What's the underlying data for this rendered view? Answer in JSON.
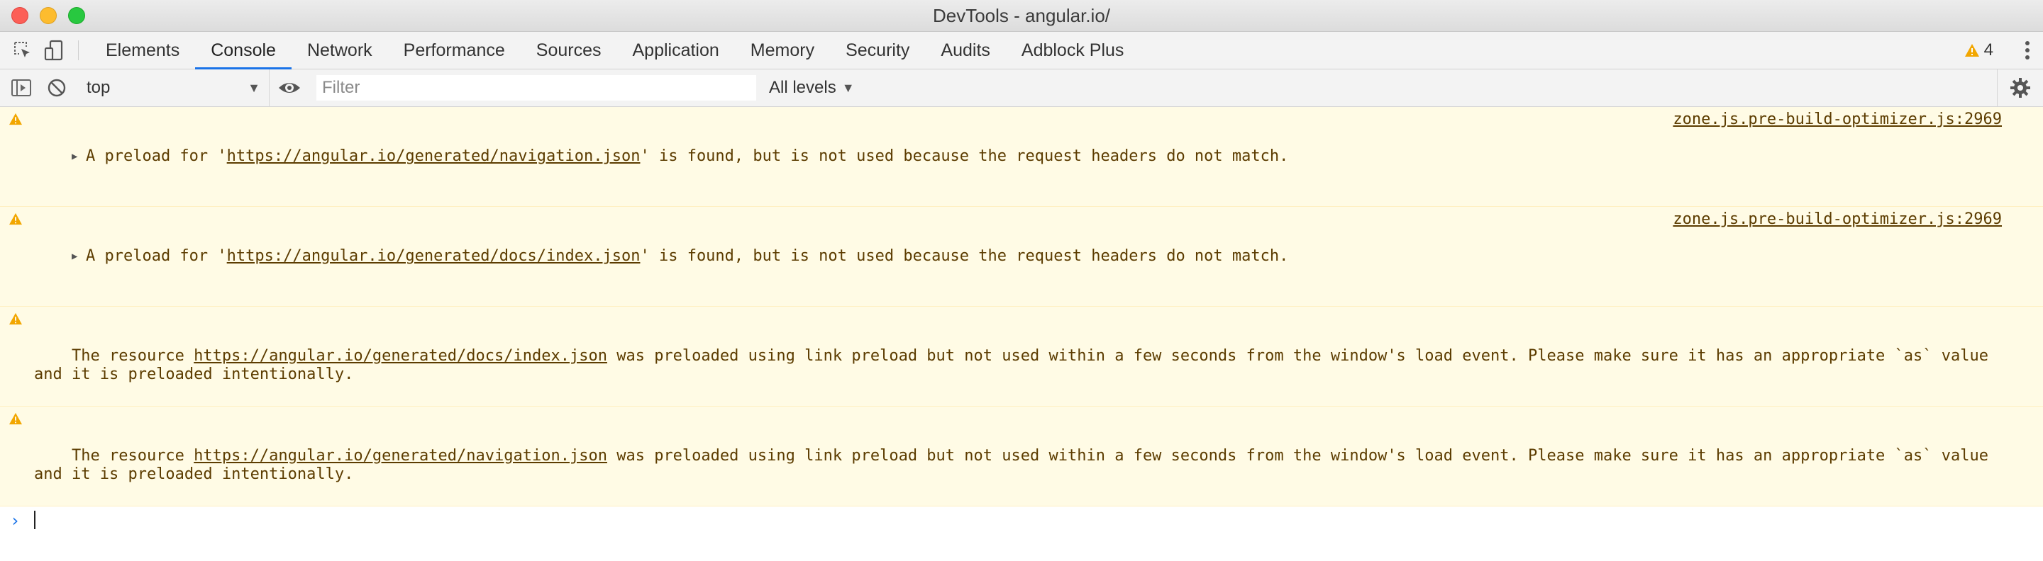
{
  "window": {
    "title": "DevTools - angular.io/"
  },
  "tabs": [
    {
      "label": "Elements"
    },
    {
      "label": "Console",
      "active": true
    },
    {
      "label": "Network"
    },
    {
      "label": "Performance"
    },
    {
      "label": "Sources"
    },
    {
      "label": "Application"
    },
    {
      "label": "Memory"
    },
    {
      "label": "Security"
    },
    {
      "label": "Audits"
    },
    {
      "label": "Adblock Plus"
    }
  ],
  "warnings_count": "4",
  "console_toolbar": {
    "context": "top",
    "filter_placeholder": "Filter",
    "levels": "All levels"
  },
  "messages": [
    {
      "prefix": "A preload for '",
      "link": "https://angular.io/generated/navigation.json",
      "suffix": "' is found, but is not used because the request headers do not match.",
      "source": "zone.js.pre-build-optimizer.js:2969"
    },
    {
      "prefix": "A preload for '",
      "link": "https://angular.io/generated/docs/index.json",
      "suffix": "' is found, but is not used because the request headers do not match.",
      "source": "zone.js.pre-build-optimizer.js:2969"
    },
    {
      "prefix": "The resource ",
      "link": "https://angular.io/generated/docs/index.json",
      "suffix": " was preloaded using link preload but not used within a few seconds from the window's load event. Please make sure it has an appropriate `as` value and it is preloaded intentionally."
    },
    {
      "prefix": "The resource ",
      "link": "https://angular.io/generated/navigation.json",
      "suffix": " was preloaded using link preload but not used within a few seconds from the window's load event. Please make sure it has an appropriate `as` value and it is preloaded intentionally."
    }
  ],
  "prompt": {
    "symbol": "›"
  },
  "colors": {
    "warning_bg": "#fffbe5",
    "warning_text": "#5c3c00",
    "warning_icon": "#f2a600",
    "active_tab_underline": "#1a73e8"
  }
}
